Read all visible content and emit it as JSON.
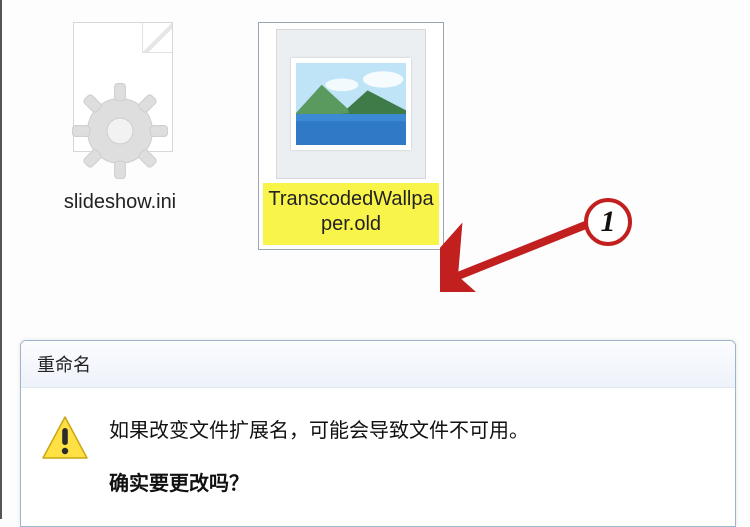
{
  "files": {
    "ini": {
      "label": "slideshow.ini"
    },
    "wallpaper": {
      "label": "TranscodedWallpaper.old"
    }
  },
  "annotation": {
    "marker": "1"
  },
  "dialog": {
    "title": "重命名",
    "message": "如果改变文件扩展名，可能会导致文件不可用。",
    "confirm": "确实要更改吗？"
  }
}
